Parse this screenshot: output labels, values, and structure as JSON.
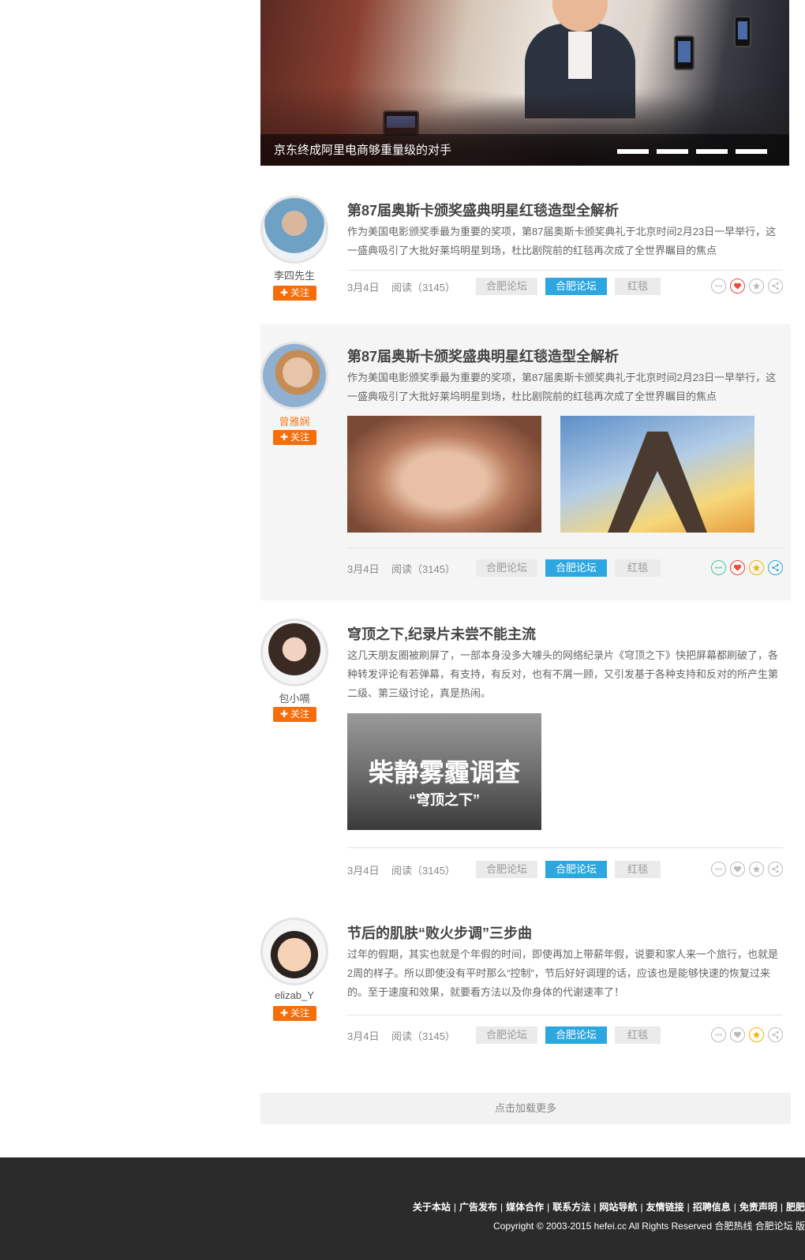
{
  "banner": {
    "caption": "京东终成阿里电商够重量级的对手",
    "slides": 4
  },
  "posts": [
    {
      "author": "李四先生",
      "follow": "关注",
      "title": "第87届奥斯卡颁奖盛典明星红毯造型全解析",
      "desc": "作为美国电影颁奖季最为重要的奖项，第87届奥斯卡颁奖典礼于北京时间2月23日一早举行，这一盛典吸引了大批好莱坞明星到场，杜比剧院前的红毯再次成了全世界瞩目的焦点",
      "date": "3月4日",
      "read": "阅读（3145）",
      "tags": [
        "合肥论坛",
        "合肥论坛",
        "红毯"
      ]
    },
    {
      "author": "曾雅娴",
      "follow": "关注",
      "title": "第87届奥斯卡颁奖盛典明星红毯造型全解析",
      "desc": "作为美国电影颁奖季最为重要的奖项，第87届奥斯卡颁奖典礼于北京时间2月23日一早举行，这一盛典吸引了大批好莱坞明星到场，杜比剧院前的红毯再次成了全世界瞩目的焦点",
      "date": "3月4日",
      "read": "阅读（3145）",
      "tags": [
        "合肥论坛",
        "合肥论坛",
        "红毯"
      ]
    },
    {
      "author": "包小嗝",
      "follow": "关注",
      "title": "穹顶之下,纪录片未尝不能主流",
      "desc": "这几天朋友圈被刷屏了，一部本身没多大噱头的网络纪录片《穹顶之下》快把屏幕都刷破了，各种转发评论有若弹幕，有支持，有反对，也有不屑一顾，又引发基于各种支持和反对的所产生第二级、第三级讨论，真是热闹。",
      "image_text": "柴静雾霾调查",
      "image_subtext": "“穹顶之下”",
      "date": "3月4日",
      "read": "阅读（3145）",
      "tags": [
        "合肥论坛",
        "合肥论坛",
        "红毯"
      ]
    },
    {
      "author": "elizab_Y",
      "follow": "关注",
      "title": "节后的肌肤“败火步调”三步曲",
      "desc": "过年的假期，其实也就是个年假的时间，即使再加上带薪年假，说要和家人来一个旅行，也就是2周的样子。所以即使没有平时那么“控制”，节后好好调理的话，应该也是能够快速的恢复过来的。至于速度和效果，就要看方法以及你身体的代谢速率了！",
      "date": "3月4日",
      "read": "阅读（3145）",
      "tags": [
        "合肥论坛",
        "合肥论坛",
        "红毯"
      ]
    }
  ],
  "load_more": "点击加载更多",
  "footer": {
    "links": [
      "关于本站",
      "广告发布",
      "媒体合作",
      "联系方法",
      "网站导航",
      "友情链接",
      "招聘信息",
      "免责声明",
      "肥肥"
    ],
    "copyright": "Copyright © 2003-2015 hefei.cc All Rights Reserved 合肥热线 合肥论坛 版"
  },
  "colors": {
    "accent_orange": "#f66e0a",
    "accent_blue": "#2ea7e0",
    "footer_bg": "#2b2b2b"
  }
}
